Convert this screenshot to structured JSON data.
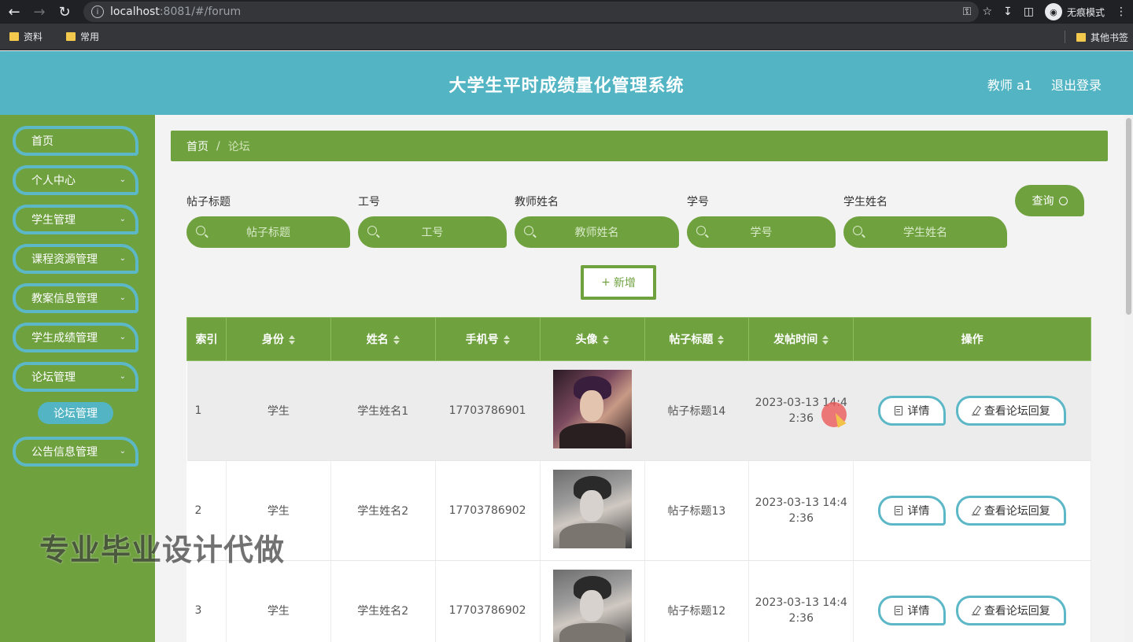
{
  "browser": {
    "url_host": "localhost",
    "url_rest": ":8081/#/forum",
    "incognito_label": "无痕模式",
    "bookmarks": [
      "资料",
      "常用"
    ],
    "other_bookmarks": "其他书签"
  },
  "header": {
    "title": "大学生平时成绩量化管理系统",
    "user": "教师 a1",
    "logout": "退出登录"
  },
  "sidebar": {
    "items": [
      {
        "label": "首页",
        "has_chevron": false
      },
      {
        "label": "个人中心",
        "has_chevron": true
      },
      {
        "label": "学生管理",
        "has_chevron": true
      },
      {
        "label": "课程资源管理",
        "has_chevron": true
      },
      {
        "label": "教案信息管理",
        "has_chevron": true
      },
      {
        "label": "学生成绩管理",
        "has_chevron": true
      },
      {
        "label": "论坛管理",
        "has_chevron": true
      },
      {
        "label": "公告信息管理",
        "has_chevron": true
      }
    ],
    "sub_item": "论坛管理"
  },
  "watermark": "专业毕业设计代做",
  "breadcrumb": {
    "home": "首页",
    "sep": "/",
    "current": "论坛"
  },
  "filters": {
    "fields": [
      {
        "label": "帖子标题",
        "placeholder": "帖子标题"
      },
      {
        "label": "工号",
        "placeholder": "工号"
      },
      {
        "label": "教师姓名",
        "placeholder": "教师姓名"
      },
      {
        "label": "学号",
        "placeholder": "学号"
      },
      {
        "label": "学生姓名",
        "placeholder": "学生姓名"
      }
    ],
    "query_label": "查询"
  },
  "add_label": "新增",
  "table": {
    "headers": [
      "索引",
      "身份",
      "姓名",
      "手机号",
      "头像",
      "帖子标题",
      "发帖时间",
      "操作"
    ],
    "rows": [
      {
        "index": "1",
        "role": "学生",
        "name": "学生姓名1",
        "phone": "17703786901",
        "title": "帖子标题14",
        "time_1": "2023-03-13 14:4",
        "time_2": "2:36"
      },
      {
        "index": "2",
        "role": "学生",
        "name": "学生姓名2",
        "phone": "17703786902",
        "title": "帖子标题13",
        "time_1": "2023-03-13 14:4",
        "time_2": "2:36"
      },
      {
        "index": "3",
        "role": "学生",
        "name": "学生姓名2",
        "phone": "17703786902",
        "title": "帖子标题12",
        "time_1": "2023-03-13 14:4",
        "time_2": "2:36"
      }
    ],
    "detail_label": "详情",
    "reply_label": "查看论坛回复"
  },
  "colors": {
    "header": "#53b5c3",
    "green": "#6fa13f",
    "teal_border": "#5cb7c7"
  }
}
